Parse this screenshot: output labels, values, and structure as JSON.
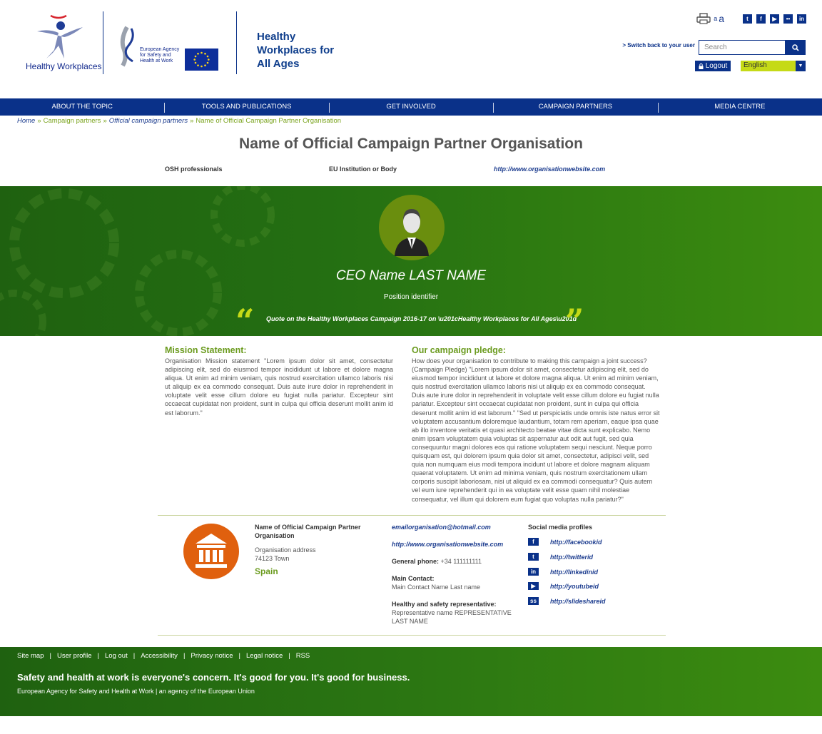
{
  "header": {
    "logo_text": "Healthy Workplaces",
    "osha_text": "European Agency for Safety and Health at Work",
    "campaign_title": "Healthy Workplaces for All Ages",
    "font_small": "a",
    "font_large": "a",
    "social": [
      "twitter-icon",
      "facebook-icon",
      "youtube-icon",
      "flickr-icon",
      "linkedin-icon"
    ],
    "switch_back": "> Switch back to your user",
    "search_placeholder": "Search",
    "logout": "Logout",
    "language": "English"
  },
  "nav": [
    "ABOUT THE TOPIC",
    "TOOLS AND PUBLICATIONS",
    "GET INVOLVED",
    "CAMPAIGN PARTNERS",
    "MEDIA CENTRE"
  ],
  "breadcrumb": {
    "home": "Home",
    "partners": "Campaign partners",
    "official": "Official campaign partners",
    "current": "Name of Official Campaign Partner Organisation",
    "sep": "»"
  },
  "org": {
    "title": "Name of Official Campaign Partner Organisation",
    "category": "OSH professionals",
    "type": "EU Institution or Body",
    "website": "http://www.organisationwebsite.com"
  },
  "hero": {
    "ceo_name": "CEO Name LAST NAME",
    "position": "Position identifier",
    "quote": "Quote on the Healthy Workplaces Campaign 2016-17 on \\u201cHealthy Workplaces for All Ages\\u201d",
    "quote_open": "“",
    "quote_close": "”"
  },
  "mission": {
    "title": "Mission Statement:",
    "body": "Organisation Mission statement \"Lorem ipsum dolor sit amet, consectetur adipiscing elit, sed do eiusmod tempor incididunt ut labore et dolore magna aliqua. Ut enim ad minim veniam, quis nostrud exercitation ullamco laboris nisi ut aliquip ex ea commodo consequat. Duis aute irure dolor in reprehenderit in voluptate velit esse cillum dolore eu fugiat nulla pariatur. Excepteur sint occaecat cupidatat non proident, sunt in culpa qui officia deserunt mollit anim id est laborum.\""
  },
  "pledge": {
    "title": "Our campaign pledge:",
    "body": "How does your organisation to contribute to making this campaign a joint success? (Campaign Pledge) \"Lorem ipsum dolor sit amet, consectetur adipiscing elit, sed do eiusmod tempor incididunt ut labore et dolore magna aliqua. Ut enim ad minim veniam, quis nostrud exercitation ullamco laboris nisi ut aliquip ex ea commodo consequat. Duis aute irure dolor in reprehenderit in voluptate velit esse cillum dolore eu fugiat nulla pariatur. Excepteur sint occaecat cupidatat non proident, sunt in culpa qui officia deserunt mollit anim id est laborum.\" \"Sed ut perspiciatis unde omnis iste natus error sit voluptatem accusantium doloremque laudantium, totam rem aperiam, eaque ipsa quae ab illo inventore veritatis et quasi architecto beatae vitae dicta sunt explicabo. Nemo enim ipsam voluptatem quia voluptas sit aspernatur aut odit aut fugit, sed quia consequuntur magni dolores eos qui ratione voluptatem sequi nesciunt. Neque porro quisquam est, qui dolorem ipsum quia dolor sit amet, consectetur, adipisci velit, sed quia non numquam eius modi tempora incidunt ut labore et dolore magnam aliquam quaerat voluptatem. Ut enim ad minima veniam, quis nostrum exercitationem ullam corporis suscipit laboriosam, nisi ut aliquid ex ea commodi consequatur? Quis autem vel eum iure reprehenderit qui in ea voluptate velit esse quam nihil molestiae consequatur, vel illum qui dolorem eum fugiat quo voluptas nulla pariatur?\""
  },
  "contact": {
    "name": "Name of Official Campaign Partner Organisation",
    "address": "Organisation address",
    "postal": "74123   Town",
    "country": "Spain",
    "email": "emailorganisation@hotmail.com",
    "website": "http://www.organisationwebsite.com",
    "phone_label": "General phone:",
    "phone": "+34 111111111",
    "main_contact_label": "Main Contact:",
    "main_contact": "Main Contact Name Last name",
    "hs_label": "Healthy and safety representative:",
    "hs_rep": "Representative name REPRESENTATIVE LAST NAME"
  },
  "social_profiles": {
    "title": "Social media profiles",
    "items": [
      {
        "icon": "facebook-icon",
        "glyph": "f",
        "url": "http://facebookid"
      },
      {
        "icon": "twitter-icon",
        "glyph": "t",
        "url": "http://twitterid"
      },
      {
        "icon": "linkedin-icon",
        "glyph": "in",
        "url": "http://linkedinid"
      },
      {
        "icon": "youtube-icon",
        "glyph": "▶",
        "url": "http://youtubeid"
      },
      {
        "icon": "slideshare-icon",
        "glyph": "ss",
        "url": "http://slideshareid"
      }
    ]
  },
  "footer": {
    "links": [
      "Site map",
      "User profile",
      "Log out",
      "Accessibility",
      "Privacy notice",
      "Legal notice",
      "RSS"
    ],
    "slogan": "Safety and health at work is everyone's concern. It's good for you. It's good for business.",
    "agency": "European Agency for Safety and Health at Work | an agency of the European Union"
  },
  "colors": {
    "brand_blue": "#0a3189",
    "green": "#6b9b1f",
    "lime": "#c5da17",
    "orange": "#e0600e"
  }
}
